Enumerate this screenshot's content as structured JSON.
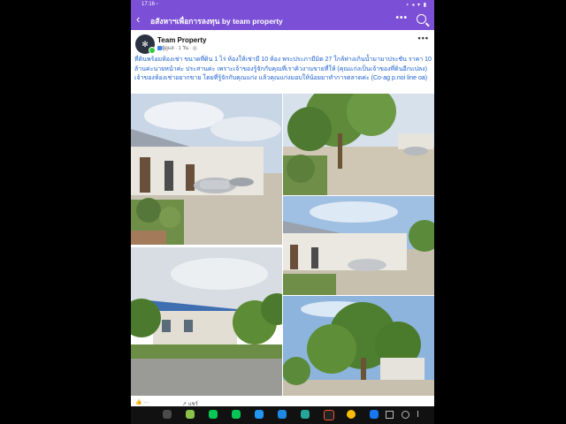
{
  "statusbar": {
    "time": "17:16 ▫",
    "icons": "▪ ◂ ▾ ▮"
  },
  "appbar": {
    "back_glyph": "‹",
    "title": "อสังหาฯเพื่อการลงทุน  by team property",
    "more_glyph": "•••"
  },
  "post": {
    "page_name": "Team Property",
    "badge": "ผู้ดูแล",
    "time": "· 1 วัน · ◎",
    "menu_glyph": "•••",
    "text": "ที่ดินพร้อมห้องเช่า ขนาดที่ดิน 1 ไร่ ห้องให้เช่ามี 10 ห้อง พระประภามีมิต 27 ใกล้ห่างเกินน้ำมามาประชัน ราคา 10 ล้านค่ะนายหน้าค่ะ ประสานค่ะ เพราะเจ้าของรู้จักกับคุณที่เราคิวงานขายที่ให้ (คุณแก่งเป็นเจ้าของที่ดินอีกแปลง) เจ้าของห้องเช่าอยากขาย โดยที่รู้จักกับคุณแก่ง แล้วคุณแก่งมอบให้น้อยมาทำการตลาดค่ะ (Co-ag p.noi line oa)"
  },
  "reactions": {
    "like": "👍  ···",
    "share": "↗ แชร์"
  },
  "colors": {
    "brand": "#7b4fd6",
    "link_text": "#1a5fd0",
    "nav_bg": "#111111"
  },
  "navbar": {
    "apps": [
      "grid-icon",
      "chat-icon",
      "line-icon",
      "line-icon-2",
      "app-icon",
      "video-icon",
      "chat-icon-2",
      "tiktok-icon",
      "chrome-icon",
      "facebook-icon"
    ],
    "system": [
      "recent-apps-icon",
      "home-icon",
      "back-icon"
    ]
  }
}
